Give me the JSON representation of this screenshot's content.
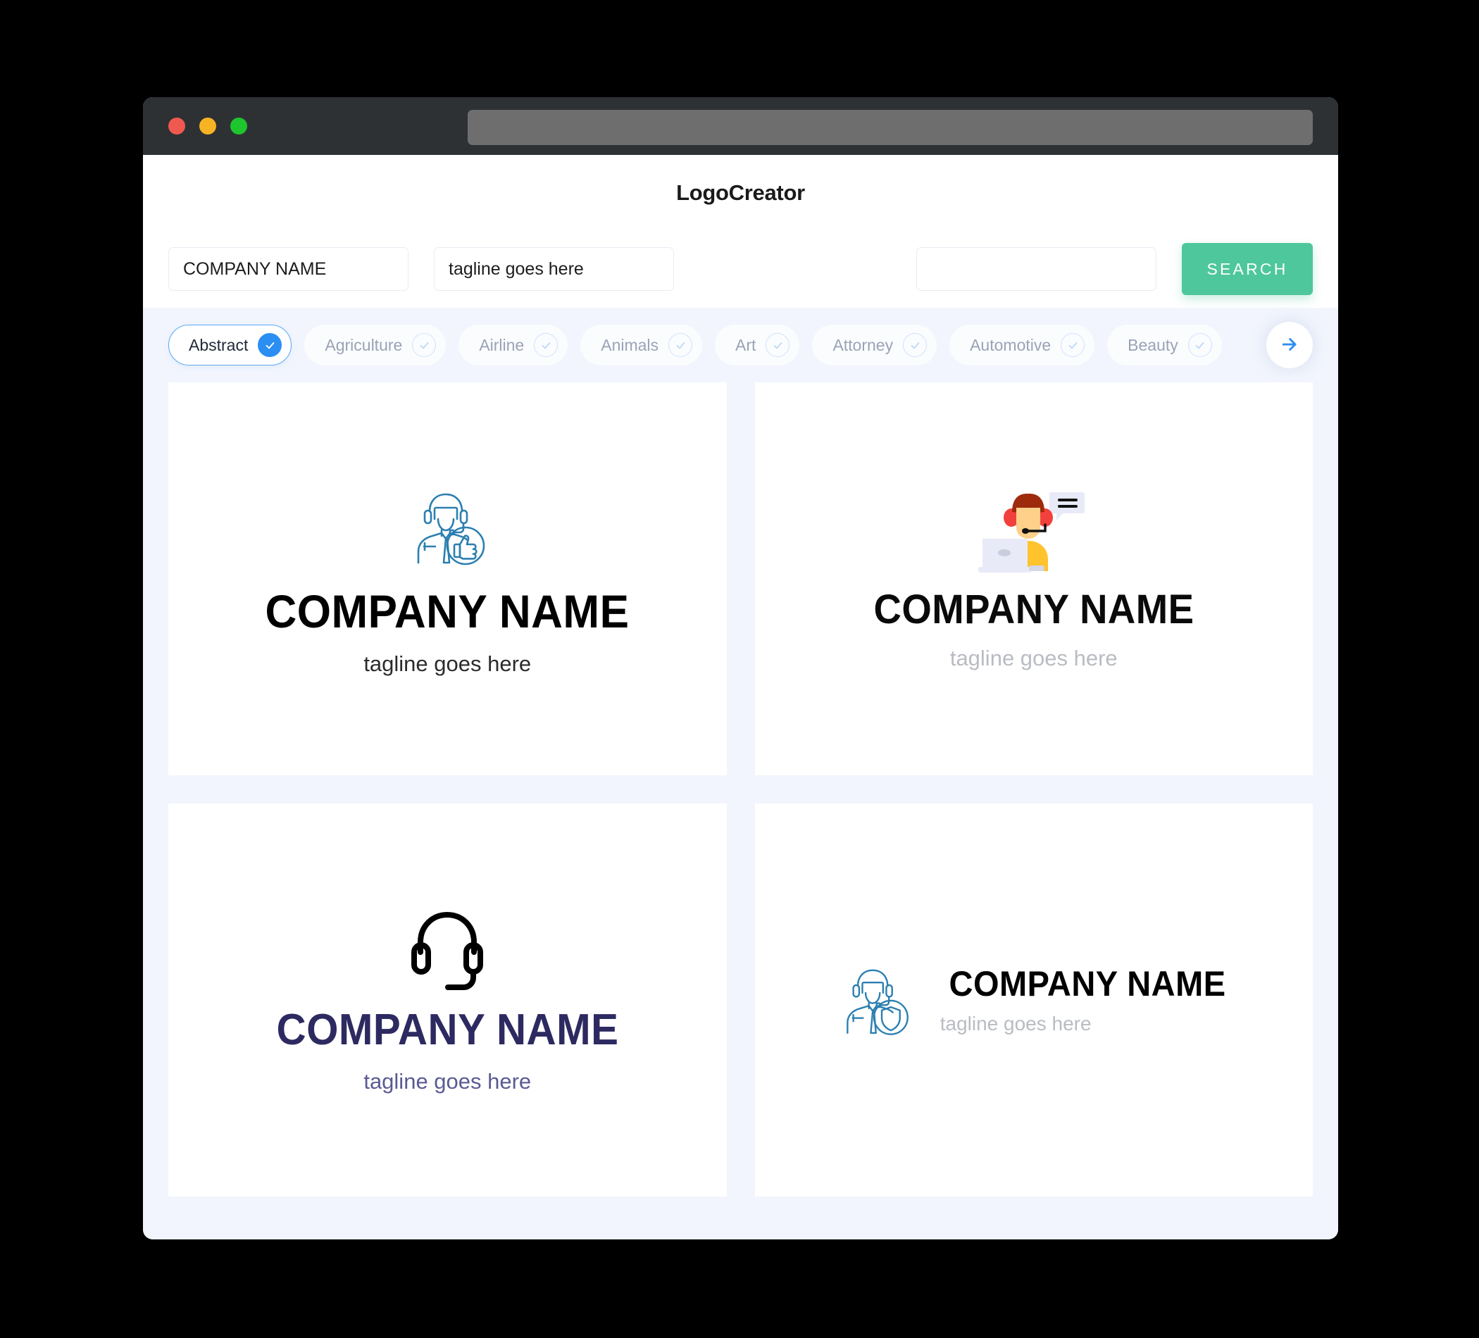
{
  "window": {
    "traffic_lights": [
      "close",
      "minimize",
      "maximize"
    ],
    "url_value": ""
  },
  "header": {
    "title": "LogoCreator"
  },
  "search": {
    "company_value": "COMPANY NAME",
    "company_placeholder": "COMPANY NAME",
    "tagline_value": "tagline goes here",
    "tagline_placeholder": "tagline goes here",
    "keyword_value": "",
    "keyword_placeholder": "",
    "button_label": "SEARCH",
    "button_color": "#4ec79c"
  },
  "categories": {
    "accent_color": "#2b8ef3",
    "next_label": "→",
    "items": [
      {
        "label": "Abstract",
        "selected": true
      },
      {
        "label": "Agriculture",
        "selected": false
      },
      {
        "label": "Airline",
        "selected": false
      },
      {
        "label": "Animals",
        "selected": false
      },
      {
        "label": "Art",
        "selected": false
      },
      {
        "label": "Attorney",
        "selected": false
      },
      {
        "label": "Automotive",
        "selected": false
      },
      {
        "label": "Beauty",
        "selected": false
      }
    ]
  },
  "results": {
    "logos": [
      {
        "icon": "support-agent-thumbsup-icon",
        "icon_color": "#2b7fb0",
        "name": "COMPANY NAME",
        "tagline": "tagline goes here",
        "name_color": "#000000",
        "tagline_color": "#2b2b2b",
        "layout": "stacked"
      },
      {
        "icon": "call-center-operator-laptop-icon",
        "icon_color": "#ffc32e",
        "name": "COMPANY NAME",
        "tagline": "tagline goes here",
        "name_color": "#0a0a0a",
        "tagline_color": "#b9bcc2",
        "layout": "stacked"
      },
      {
        "icon": "headset-icon",
        "icon_color": "#000000",
        "name": "COMPANY NAME",
        "tagline": "tagline goes here",
        "name_color": "#2d2a61",
        "tagline_color": "#5b5a94",
        "layout": "stacked"
      },
      {
        "icon": "support-agent-shield-icon",
        "icon_color": "#2b7fb0",
        "name": "COMPANY NAME",
        "tagline": "tagline goes here",
        "name_color": "#000000",
        "tagline_color": "#b9bcc2",
        "layout": "horizontal"
      }
    ]
  }
}
